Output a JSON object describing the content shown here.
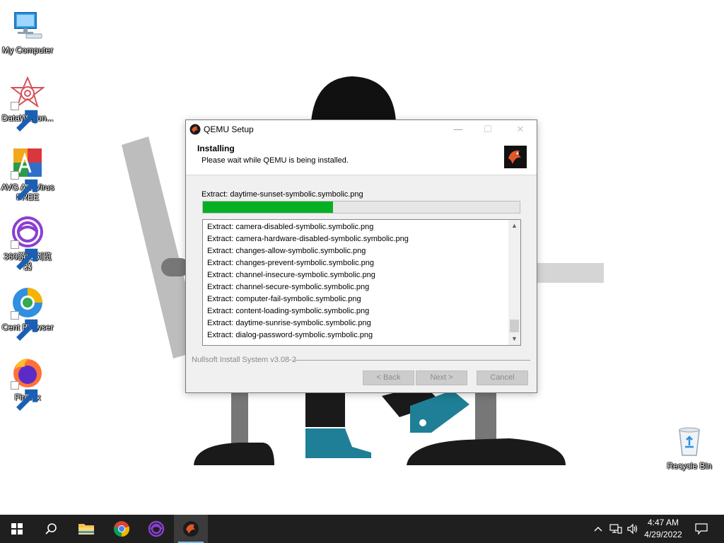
{
  "desktop": {
    "icons": [
      {
        "label": "My Computer",
        "icon": "computer-icon"
      },
      {
        "label": "DataWagon...",
        "icon": "datawagon-icon"
      },
      {
        "label": "AVG AntiVirus FREE",
        "icon": "avg-icon"
      },
      {
        "label": "360游戏浏览器",
        "icon": "360-game-browser-icon"
      },
      {
        "label": "Cent Browser",
        "icon": "cent-browser-icon"
      },
      {
        "label": "Firefox",
        "icon": "firefox-icon"
      },
      {
        "label": "Recycle Bin",
        "icon": "recycle-bin-icon"
      }
    ]
  },
  "dialog": {
    "title": "QEMU Setup",
    "heading": "Installing",
    "subheading": "Please wait while QEMU is being installed.",
    "status": "Extract: daytime-sunset-symbolic.symbolic.png",
    "progress_fraction": 0.41,
    "log": [
      "Extract: camera-disabled-symbolic.symbolic.png",
      "Extract: camera-hardware-disabled-symbolic.symbolic.png",
      "Extract: changes-allow-symbolic.symbolic.png",
      "Extract: changes-prevent-symbolic.symbolic.png",
      "Extract: channel-insecure-symbolic.symbolic.png",
      "Extract: channel-secure-symbolic.symbolic.png",
      "Extract: computer-fail-symbolic.symbolic.png",
      "Extract: content-loading-symbolic.symbolic.png",
      "Extract: daytime-sunrise-symbolic.symbolic.png",
      "Extract: dialog-password-symbolic.symbolic.png"
    ],
    "branding": "Nullsoft Install System v3.08-2",
    "buttons": {
      "back": "< Back",
      "next": "Next >",
      "cancel": "Cancel"
    },
    "controls": {
      "minimize": "—",
      "maximize": "☐",
      "close": "✕"
    }
  },
  "taskbar": {
    "items": [
      "start-icon",
      "search-icon",
      "file-explorer-icon",
      "chrome-icon",
      "360-game-browser-icon",
      "qemu-setup-icon"
    ],
    "active": "qemu-setup-icon",
    "clock": {
      "time": "4:47 AM",
      "date": "4/29/2022"
    }
  },
  "colors": {
    "progress": "#06b025",
    "taskbar": "#1f1f1f",
    "accent": "#76b9ed"
  }
}
